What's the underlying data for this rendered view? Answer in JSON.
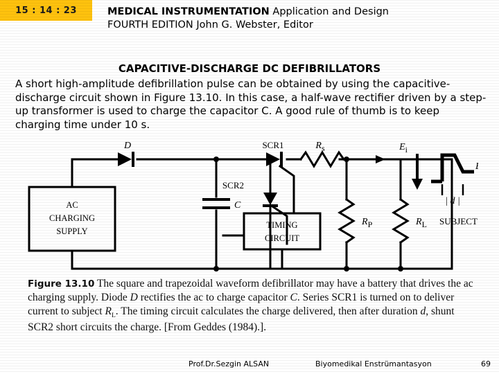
{
  "timer": {
    "label": "15 : 14 : 23"
  },
  "header": {
    "title_bold": "MEDICAL INSTRUMENTATION",
    "title_rest": " Application and Design",
    "edition": "FOURTH EDITION  John G. Webster, Editor"
  },
  "section": {
    "heading": "CAPACITIVE-DISCHARGE DC DEFIBRILLATORS",
    "paragraph": "A short high-amplitude defibrillation pulse can be obtained by using the capacitive-discharge circuit shown in Figure 13.10. In this case, a half-wave rectifier driven by a step-up transformer is used to charge the capacitor C. A good rule of thumb is to keep charging time under 10 s."
  },
  "figure": {
    "number": "Figure 13.10",
    "caption_part1": "  The square and trapezoidal waveform defibrillator may have a battery that drives the ac charging supply. Diode ",
    "caption_D": "D",
    "caption_part2": " rectifies the ac to charge capacitor ",
    "caption_C": "C",
    "caption_part3": ". Series SCR1 is turned on to deliver current to subject ",
    "caption_RL": "R",
    "caption_RL_sub": "L",
    "caption_part4": ". The timing circuit calculates the charge delivered, then after duration ",
    "caption_d": "d",
    "caption_part5": ", shunt SCR2 short circuits the charge. [From Geddes (1984).].",
    "circuit": {
      "source_box": [
        "AC",
        "CHARGING",
        "SUPPLY"
      ],
      "timing_box": [
        "TIMING",
        "CIRCUIT"
      ],
      "diode_label": "D",
      "capacitor_label": "C",
      "scr1_label": "SCR1",
      "scr2_label": "SCR2",
      "rs_label": "R",
      "rs_sub": "s",
      "rp_label": "R",
      "rp_sub": "P",
      "rl_label": "R",
      "rl_sub": "L",
      "subject_label": "SUBJECT",
      "ei_label": "E",
      "ei_sub": "i",
      "ef_label": "E",
      "ef_sub": "f",
      "d_label": "| d |"
    }
  },
  "footer": {
    "author": "Prof.Dr.Sezgin ALSAN",
    "course": "Biyomedikal Enstrümantasyon",
    "page": "69"
  },
  "colors": {
    "timer_bg": "#FFC20E",
    "text": "#000000",
    "slide_bg": "#FFFFFF"
  }
}
